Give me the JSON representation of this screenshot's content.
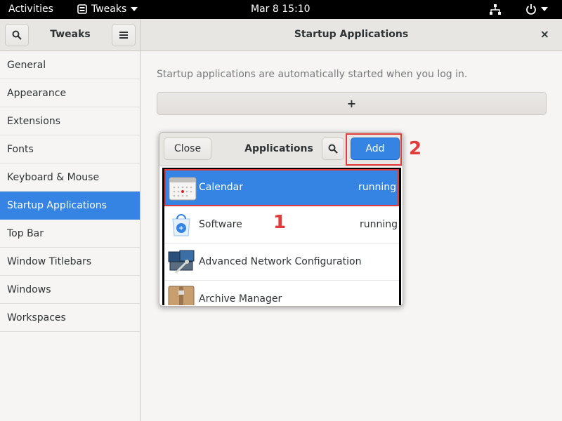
{
  "topbar": {
    "activities": "Activities",
    "app_name": "Tweaks",
    "datetime": "Mar 8  15:10"
  },
  "tweaks": {
    "title": "Tweaks"
  },
  "sidebar": {
    "items": [
      {
        "label": "General"
      },
      {
        "label": "Appearance"
      },
      {
        "label": "Extensions"
      },
      {
        "label": "Fonts"
      },
      {
        "label": "Keyboard & Mouse"
      },
      {
        "label": "Startup Applications",
        "active": true
      },
      {
        "label": "Top Bar"
      },
      {
        "label": "Window Titlebars"
      },
      {
        "label": "Windows"
      },
      {
        "label": "Workspaces"
      }
    ]
  },
  "page": {
    "title": "Startup Applications",
    "close_label": "×",
    "description": "Startup applications are automatically started when you log in.",
    "add_label": "+"
  },
  "dialog": {
    "close_label": "Close",
    "title": "Applications",
    "add_label": "Add",
    "apps": [
      {
        "name": "Calendar",
        "state": "running",
        "icon": "calendar-icon"
      },
      {
        "name": "Software",
        "state": "running",
        "icon": "software-icon"
      },
      {
        "name": "Advanced Network Configuration",
        "state": "",
        "icon": "network-config-icon"
      },
      {
        "name": "Archive Manager",
        "state": "",
        "icon": "archive-manager-icon"
      }
    ]
  },
  "annotations": {
    "step1": "1",
    "step2": "2"
  },
  "colors": {
    "accent": "#3584e4",
    "highlight": "#e03c3c"
  }
}
